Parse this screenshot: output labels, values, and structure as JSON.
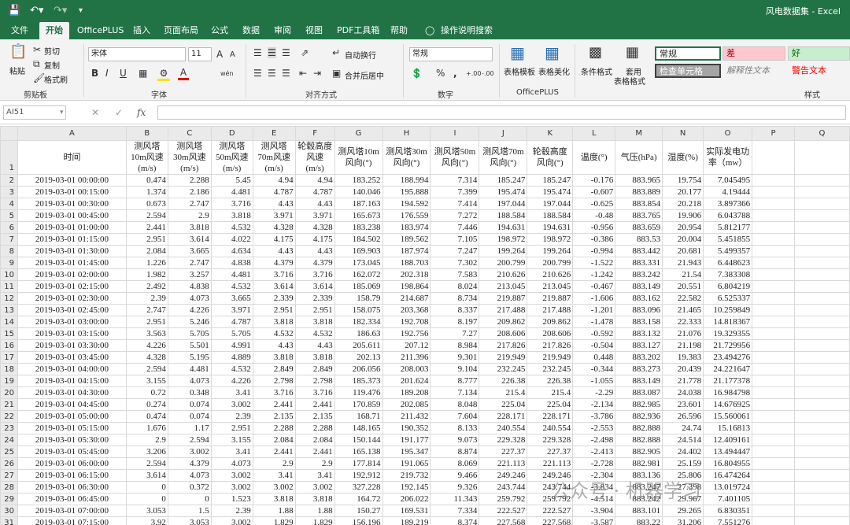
{
  "window": {
    "title": "风电数据集 - Excel"
  },
  "tabs": [
    "文件",
    "开始",
    "OfficePLUS",
    "插入",
    "页面布局",
    "公式",
    "数据",
    "审阅",
    "视图",
    "PDF工具箱",
    "帮助"
  ],
  "search": {
    "label": "操作说明搜索"
  },
  "ribbon": {
    "clipboard": {
      "group": "剪贴板",
      "paste": "粘贴",
      "cut": "剪切",
      "copy": "复制",
      "format_painter": "格式刷"
    },
    "font": {
      "group": "字体",
      "name": "宋体",
      "size": "11",
      "bold": "B",
      "italic": "I",
      "underline": "U",
      "grow": "A",
      "shrink": "A",
      "color_a": "A",
      "phonetic": "wén"
    },
    "alignment": {
      "group": "对齐方式",
      "wrap": "自动换行",
      "merge": "合并后居中"
    },
    "number": {
      "group": "数字",
      "format": "常规",
      "percent": "%",
      "comma": ",",
      "inc_dec": "+.00",
      "dec_dec": "-.00"
    },
    "officeplus": {
      "group": "OfficePLUS",
      "template": "表格模板",
      "beautify": "表格美化"
    },
    "styles": {
      "group": "样式",
      "conditional": "条件格式",
      "table_format_1": "套用",
      "table_format_2": "表格格式",
      "normal": "常规",
      "bad": "差",
      "good": "好",
      "check": "检查单元格",
      "explain": "解释性文本",
      "warning": "警告文本"
    }
  },
  "namebox": "AI51",
  "fx": "fx",
  "columns": [
    "A",
    "B",
    "C",
    "D",
    "E",
    "F",
    "G",
    "H",
    "I",
    "J",
    "K",
    "L",
    "M",
    "N",
    "O",
    "P",
    "Q"
  ],
  "header_row": [
    "时间",
    "测风塔10m风速(m/s)",
    "测风塔30m风速(m/s)",
    "测风塔50m风速(m/s)",
    "测风塔70m风速(m/s)",
    "轮毂高度风速(m/s)",
    "测风塔10m风向(°)",
    "测风塔30m风向(°)",
    "测风塔50m风向(°)",
    "测风塔70m风向(°)",
    "轮毂高度风向(°)",
    "温度(°)",
    "气压(hPa)",
    "湿度(%)",
    "实际发电功率（mw）"
  ],
  "rows": [
    [
      "2019-03-01 00:00:00",
      "0.474",
      "2.288",
      "5.45",
      "4.94",
      "4.94",
      "183.252",
      "188.994",
      "7.314",
      "185.247",
      "185.247",
      "-0.176",
      "883.965",
      "19.754",
      "7.045495"
    ],
    [
      "2019-03-01 00:15:00",
      "1.374",
      "2.186",
      "4.481",
      "4.787",
      "4.787",
      "140.046",
      "195.888",
      "7.399",
      "195.474",
      "195.474",
      "-0.607",
      "883.889",
      "20.177",
      "4.19444"
    ],
    [
      "2019-03-01 00:30:00",
      "0.673",
      "2.747",
      "3.716",
      "4.43",
      "4.43",
      "187.163",
      "194.592",
      "7.414",
      "197.044",
      "197.044",
      "-0.625",
      "883.854",
      "20.218",
      "3.897366"
    ],
    [
      "2019-03-01 00:45:00",
      "2.594",
      "2.9",
      "3.818",
      "3.971",
      "3.971",
      "165.673",
      "176.559",
      "7.272",
      "188.584",
      "188.584",
      "-0.48",
      "883.765",
      "19.906",
      "6.043788"
    ],
    [
      "2019-03-01 01:00:00",
      "2.441",
      "3.818",
      "4.532",
      "4.328",
      "4.328",
      "183.238",
      "183.974",
      "7.446",
      "194.631",
      "194.631",
      "-0.956",
      "883.659",
      "20.954",
      "5.812177"
    ],
    [
      "2019-03-01 01:15:00",
      "2.951",
      "3.614",
      "4.022",
      "4.175",
      "4.175",
      "184.502",
      "189.562",
      "7.105",
      "198.972",
      "198.972",
      "-0.386",
      "883.53",
      "20.004",
      "5.451855"
    ],
    [
      "2019-03-01 01:30:00",
      "2.084",
      "3.665",
      "4.634",
      "4.43",
      "4.43",
      "169.903",
      "187.974",
      "7.247",
      "199.264",
      "199.264",
      "-0.994",
      "883.442",
      "20.681",
      "5.499357"
    ],
    [
      "2019-03-01 01:45:00",
      "1.226",
      "2.747",
      "4.838",
      "4.379",
      "4.379",
      "173.045",
      "188.703",
      "7.302",
      "200.799",
      "200.799",
      "-1.522",
      "883.331",
      "21.943",
      "6.448623"
    ],
    [
      "2019-03-01 02:00:00",
      "1.982",
      "3.257",
      "4.481",
      "3.716",
      "3.716",
      "162.072",
      "202.318",
      "7.583",
      "210.626",
      "210.626",
      "-1.242",
      "883.242",
      "21.54",
      "7.383308"
    ],
    [
      "2019-03-01 02:15:00",
      "2.492",
      "4.838",
      "4.532",
      "3.614",
      "3.614",
      "185.069",
      "198.864",
      "8.024",
      "213.045",
      "213.045",
      "-0.467",
      "883.149",
      "20.551",
      "6.804219"
    ],
    [
      "2019-03-01 02:30:00",
      "2.39",
      "4.073",
      "3.665",
      "2.339",
      "2.339",
      "158.79",
      "214.687",
      "8.734",
      "219.887",
      "219.887",
      "-1.606",
      "883.162",
      "22.582",
      "6.525337"
    ],
    [
      "2019-03-01 02:45:00",
      "2.747",
      "4.226",
      "3.971",
      "2.951",
      "2.951",
      "158.075",
      "203.368",
      "8.337",
      "217.488",
      "217.488",
      "-1.201",
      "883.096",
      "21.465",
      "10.259849"
    ],
    [
      "2019-03-01 03:00:00",
      "2.951",
      "5.246",
      "4.787",
      "3.818",
      "3.818",
      "182.334",
      "192.708",
      "8.197",
      "209.862",
      "209.862",
      "-1.478",
      "883.158",
      "22.333",
      "14.818367"
    ],
    [
      "2019-03-01 03:15:00",
      "3.563",
      "5.705",
      "5.705",
      "4.532",
      "4.532",
      "186.63",
      "192.756",
      "7.27",
      "208.606",
      "208.606",
      "-0.592",
      "883.132",
      "21.076",
      "19.329355"
    ],
    [
      "2019-03-01 03:30:00",
      "4.226",
      "5.501",
      "4.991",
      "4.43",
      "4.43",
      "205.611",
      "207.12",
      "8.984",
      "217.826",
      "217.826",
      "-0.504",
      "883.127",
      "21.198",
      "21.729956"
    ],
    [
      "2019-03-01 03:45:00",
      "4.328",
      "5.195",
      "4.889",
      "3.818",
      "3.818",
      "202.13",
      "211.396",
      "9.301",
      "219.949",
      "219.949",
      "0.448",
      "883.202",
      "19.383",
      "23.494276"
    ],
    [
      "2019-03-01 04:00:00",
      "2.594",
      "4.481",
      "4.532",
      "2.849",
      "2.849",
      "206.056",
      "208.003",
      "9.104",
      "232.245",
      "232.245",
      "-0.344",
      "883.273",
      "20.439",
      "24.221647"
    ],
    [
      "2019-03-01 04:15:00",
      "3.155",
      "4.073",
      "4.226",
      "2.798",
      "2.798",
      "185.373",
      "201.624",
      "8.777",
      "226.38",
      "226.38",
      "-1.055",
      "883.149",
      "21.778",
      "21.177378"
    ],
    [
      "2019-03-01 04:30:00",
      "0.72",
      "0.348",
      "3.41",
      "3.716",
      "3.716",
      "119.476",
      "189.208",
      "7.134",
      "215.4",
      "215.4",
      "-2.29",
      "883.087",
      "24.038",
      "16.984798"
    ],
    [
      "2019-03-01 04:45:00",
      "0.274",
      "0.074",
      "3.002",
      "2.441",
      "2.441",
      "170.859",
      "202.085",
      "8.048",
      "225.04",
      "225.04",
      "-2.134",
      "882.985",
      "23.601",
      "14.676925"
    ],
    [
      "2019-03-01 05:00:00",
      "0.474",
      "0.074",
      "2.39",
      "2.135",
      "2.135",
      "168.71",
      "211.432",
      "7.604",
      "228.171",
      "228.171",
      "-3.786",
      "882.936",
      "26.596",
      "15.560061"
    ],
    [
      "2019-03-01 05:15:00",
      "1.676",
      "1.17",
      "2.951",
      "2.288",
      "2.288",
      "148.165",
      "190.352",
      "8.133",
      "240.554",
      "240.554",
      "-2.553",
      "882.888",
      "24.74",
      "15.16813"
    ],
    [
      "2019-03-01 05:30:00",
      "2.9",
      "2.594",
      "3.155",
      "2.084",
      "2.084",
      "150.144",
      "191.177",
      "9.073",
      "229.328",
      "229.328",
      "-2.498",
      "882.888",
      "24.514",
      "12.409161"
    ],
    [
      "2019-03-01 05:45:00",
      "3.206",
      "3.002",
      "3.41",
      "2.441",
      "2.441",
      "165.138",
      "195.347",
      "8.874",
      "227.37",
      "227.37",
      "-2.413",
      "882.905",
      "24.402",
      "13.494447"
    ],
    [
      "2019-03-01 06:00:00",
      "2.594",
      "4.379",
      "4.073",
      "2.9",
      "2.9",
      "177.814",
      "191.065",
      "8.069",
      "221.113",
      "221.113",
      "-2.728",
      "882.981",
      "25.159",
      "16.804955"
    ],
    [
      "2019-03-01 06:15:00",
      "3.614",
      "4.073",
      "3.002",
      "3.41",
      "3.41",
      "192.912",
      "219.732",
      "9.466",
      "249.246",
      "249.246",
      "-2.304",
      "883.136",
      "25.806",
      "16.474264"
    ],
    [
      "2019-03-01 06:30:00",
      "0",
      "0.372",
      "3.002",
      "3.002",
      "3.002",
      "327.228",
      "192.145",
      "9.326",
      "243.744",
      "243.744",
      "-3.834",
      "883.247",
      "27.398",
      "13.019724"
    ],
    [
      "2019-03-01 06:45:00",
      "0",
      "0",
      "1.523",
      "3.818",
      "3.818",
      "164.72",
      "206.022",
      "11.343",
      "259.792",
      "259.792",
      "-4.514",
      "883.242",
      "29.967",
      "7.401105"
    ],
    [
      "2019-03-01 07:00:00",
      "3.053",
      "1.5",
      "2.39",
      "1.88",
      "1.88",
      "150.27",
      "169.531",
      "7.334",
      "222.527",
      "222.527",
      "-3.904",
      "883.101",
      "29.265",
      "6.830351"
    ],
    [
      "2019-03-01 07:15:00",
      "3.92",
      "3.053",
      "3.002",
      "1.829",
      "1.829",
      "156.196",
      "189.219",
      "8.374",
      "227.568",
      "227.568",
      "-3.587",
      "883.22",
      "31.206",
      "7.551276"
    ]
  ],
  "watermark": "公众号 · 机器学习"
}
